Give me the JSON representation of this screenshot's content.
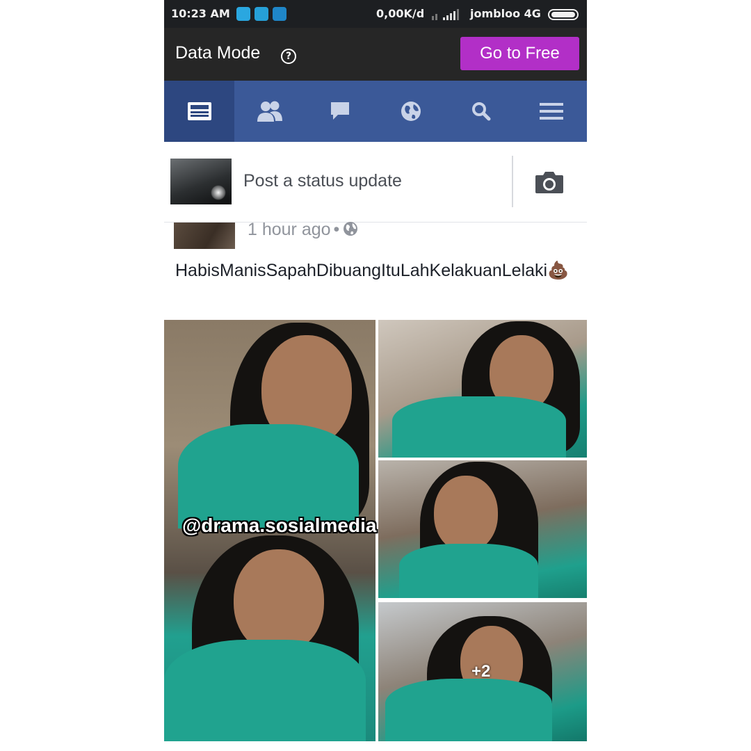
{
  "status_bar": {
    "time": "10:23 AM",
    "network_speed": "0,00K/d",
    "carrier": "jombloo 4G"
  },
  "data_mode": {
    "title": "Data Mode",
    "help_icon": "?",
    "free_button": "Go to Free",
    "button_color": "#b22fc7"
  },
  "nav": {
    "tabs": [
      {
        "icon": "news-feed-icon",
        "active": true
      },
      {
        "icon": "friends-icon",
        "active": false
      },
      {
        "icon": "messages-icon",
        "active": false
      },
      {
        "icon": "notifications-globe-icon",
        "active": false
      },
      {
        "icon": "search-icon",
        "active": false
      },
      {
        "icon": "menu-icon",
        "active": false
      }
    ],
    "color": "#3b5998"
  },
  "composer": {
    "placeholder": "Post a status update",
    "camera_icon": "camera-icon"
  },
  "post": {
    "timestamp": "1 hour ago",
    "separator": "•",
    "privacy_icon": "globe-icon",
    "text": "HabisManisSapahDibuangItuLahKelakuanLelaki💩",
    "more_photos": "+2"
  },
  "watermark": "@drama.sosialmedia"
}
